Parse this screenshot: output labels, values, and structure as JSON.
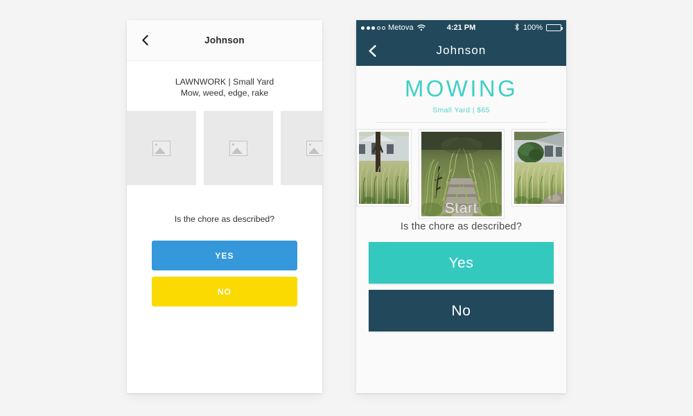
{
  "wireframe": {
    "back_icon": "chevron-left-icon",
    "title": "Johnson",
    "chore_title": "LAWNWORK | Small Yard",
    "chore_tasks": "Mow, weed, edge, rake",
    "photo_placeholders": [
      {
        "icon": "image-placeholder-icon"
      },
      {
        "icon": "image-placeholder-icon"
      },
      {
        "icon": "image-placeholder-icon"
      }
    ],
    "question": "Is the chore as described?",
    "yes_label": "YES",
    "no_label": "NO",
    "yes_color": "#3498db",
    "no_color": "#fada00"
  },
  "phone": {
    "status_bar": {
      "signal_dots_filled": 3,
      "signal_dots_hollow": 2,
      "carrier": "Metova",
      "wifi_icon": "wifi-icon",
      "time": "4:21 PM",
      "bluetooth_icon": "bluetooth-icon",
      "battery_percent": "100%",
      "battery_icon": "battery-full-icon"
    },
    "nav": {
      "back_icon": "chevron-left-icon",
      "title": "Johnson",
      "bar_color": "#21495b"
    },
    "hero": {
      "title": "MOWING",
      "subtitle": "Small Yard | $65",
      "title_color": "#3fd0c6"
    },
    "photos": [
      {
        "alt": "overgrown-grass-house-photo"
      },
      {
        "alt": "overgrown-steps-photo"
      },
      {
        "alt": "overgrown-yard-shrub-photo"
      }
    ],
    "ghost_overlay": "Start",
    "question": "Is the chore as described?",
    "yes_label": "Yes",
    "no_label": "No",
    "yes_color": "#34c9be",
    "no_color": "#21495b"
  }
}
